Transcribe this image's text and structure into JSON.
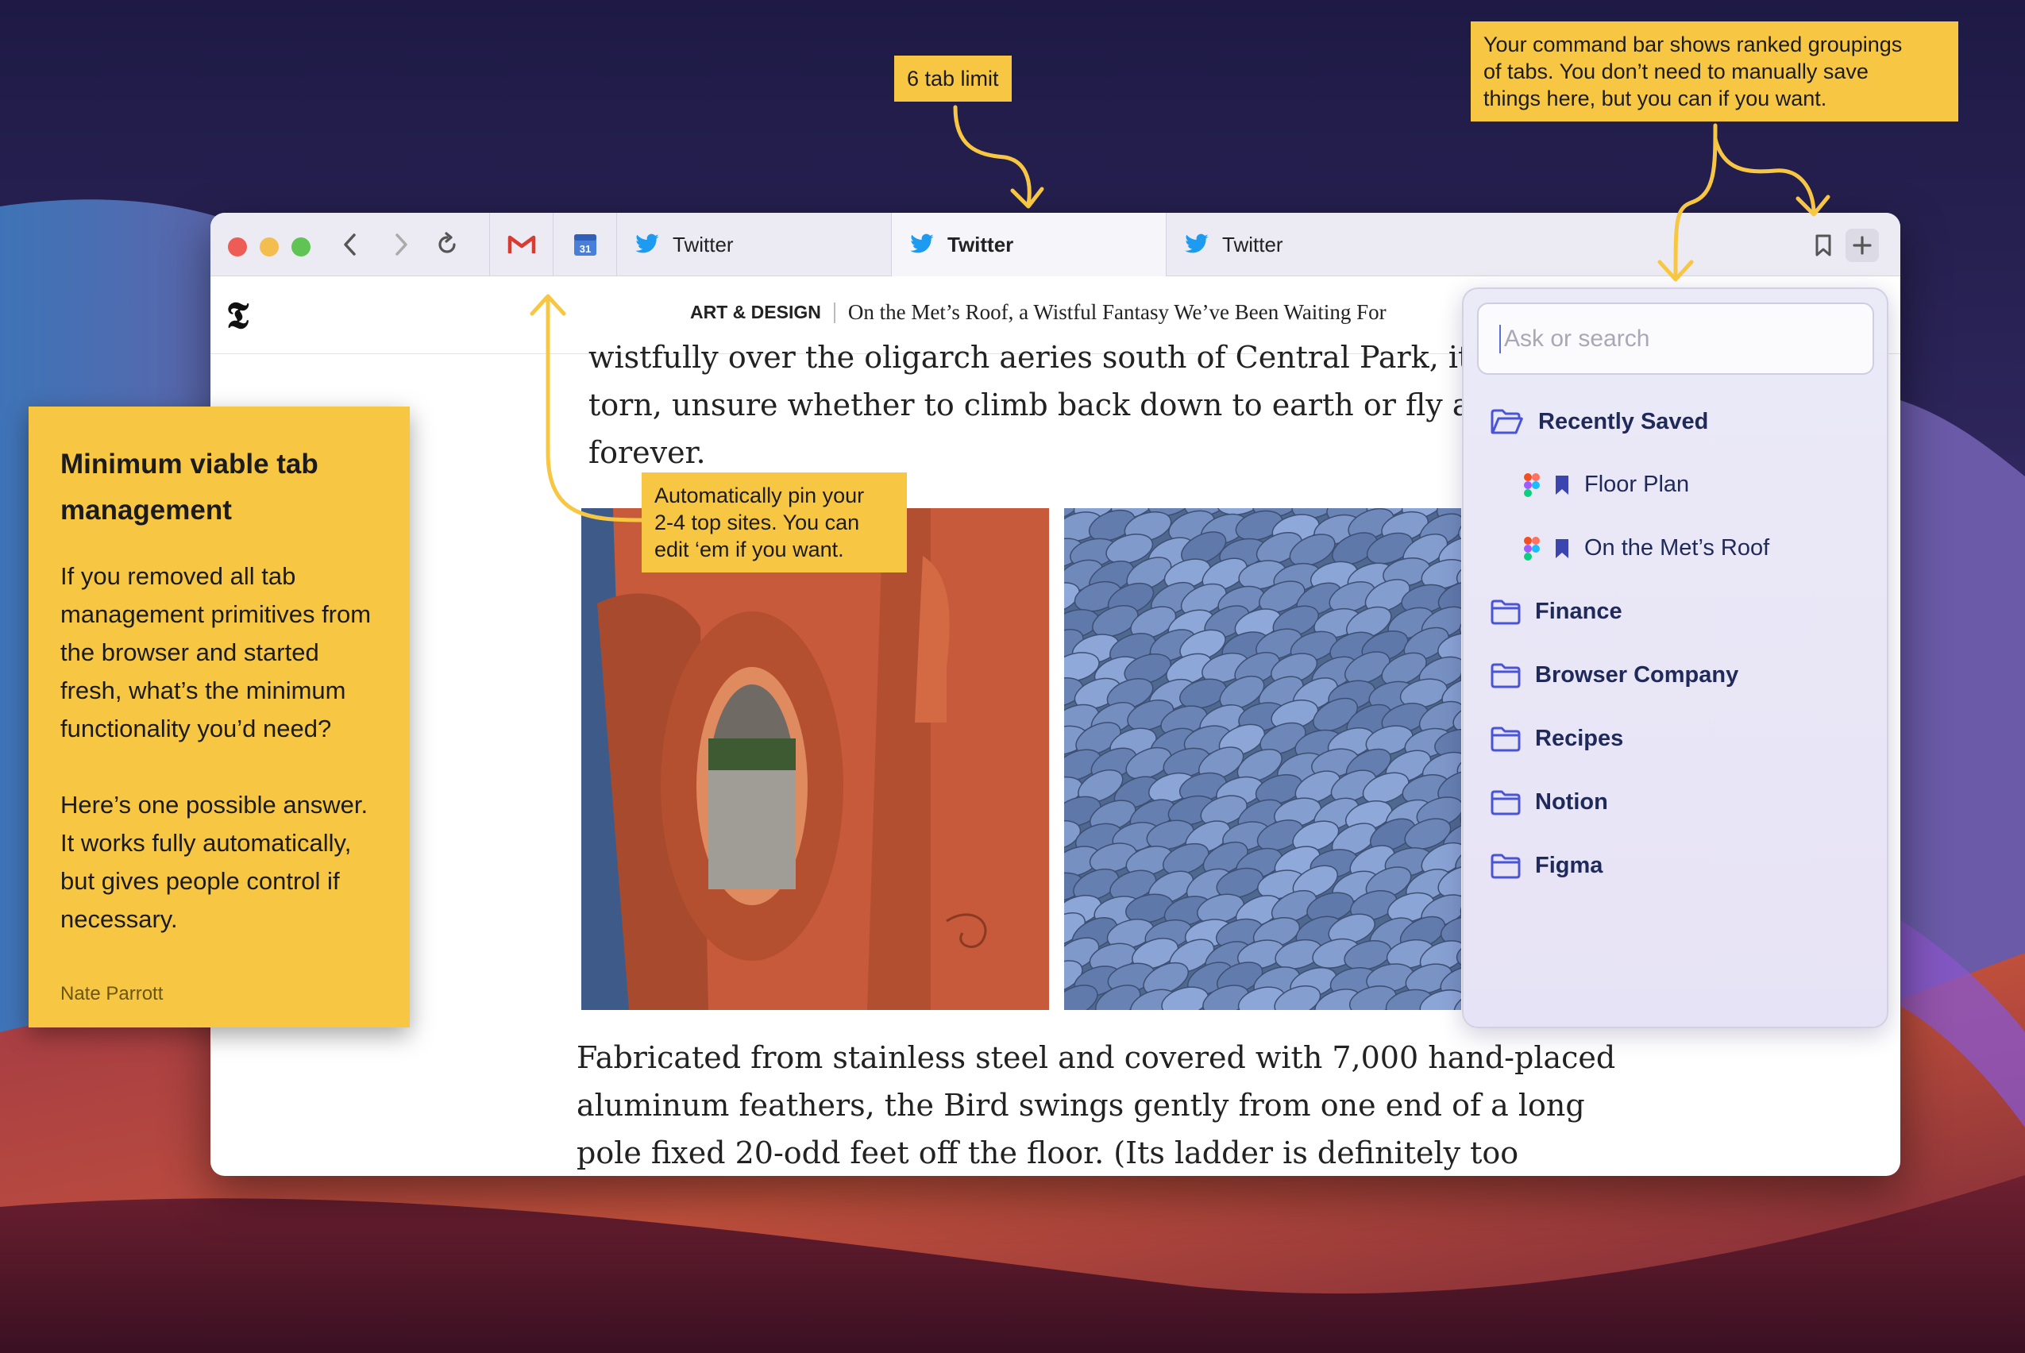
{
  "colors": {
    "note_yellow": "#f7c744",
    "arrow_yellow": "#f7c744",
    "folder_blue": "#4a55d6",
    "twitter_blue": "#1d9bf0",
    "traffic_red": "#ed5d55",
    "traffic_yellow": "#f4bd4f",
    "traffic_green": "#5fc454"
  },
  "notes": {
    "tab_limit": "6 tab limit",
    "command_bar": [
      "Your command bar shows ranked groupings",
      "of tabs. You don’t need to manually save",
      "things here, but you can if you want."
    ],
    "pin": [
      "Automatically pin your",
      "2-4 top sites. You can",
      "edit ‘em if you want."
    ],
    "main": {
      "title": [
        "Minimum viable tab",
        "management"
      ],
      "para1": [
        "If you removed all tab",
        "management primitives from",
        "the browser and started",
        "fresh, what’s the minimum",
        "functionality you’d need?"
      ],
      "para2": [
        "Here’s one possible answer.",
        "It works fully automatically,",
        "but gives people control if",
        "necessary."
      ],
      "author": "Nate Parrott"
    }
  },
  "browser": {
    "toolbar": {
      "back_icon": "chevron-left-icon",
      "forward_icon": "chevron-right-icon",
      "reload_icon": "reload-icon",
      "bookmark_icon": "bookmark-icon",
      "new_tab_icon": "plus-icon"
    },
    "pinned": [
      {
        "name": "gmail",
        "icon": "gmail-icon"
      },
      {
        "name": "calendar",
        "icon": "calendar-icon",
        "day": "31"
      }
    ],
    "tabs": [
      {
        "label": "Twitter",
        "icon": "twitter-icon",
        "active": false
      },
      {
        "label": "Twitter",
        "icon": "twitter-icon",
        "active": true
      },
      {
        "label": "Twitter",
        "icon": "twitter-icon",
        "active": false
      }
    ]
  },
  "page": {
    "logo": "𝕿",
    "section": "ART & DESIGN",
    "headline": "On the Met’s Roof, a Wistful Fantasy We’ve Been Waiting For",
    "paragraph_top": [
      "wistfully over the oligarch aeries south of Central Park, it look",
      "torn, unsure whether to climb back down to earth or fly away",
      "forever."
    ],
    "paragraph_bottom": [
      "Fabricated from stainless steel and covered with 7,000 hand-placed",
      "aluminum feathers, the Bird swings gently from one end of a long",
      "pole fixed 20-odd feet off the floor. (Its ladder is definitely too"
    ]
  },
  "command_bar": {
    "search_placeholder": "Ask or search",
    "recently_saved": "Recently Saved",
    "saved_items": [
      {
        "label": "Floor Plan",
        "icon": "figma-icon"
      },
      {
        "label": "On the Met’s Roof",
        "icon": "figma-icon"
      }
    ],
    "folders": [
      "Finance",
      "Browser Company",
      "Recipes",
      "Notion",
      "Figma"
    ]
  }
}
